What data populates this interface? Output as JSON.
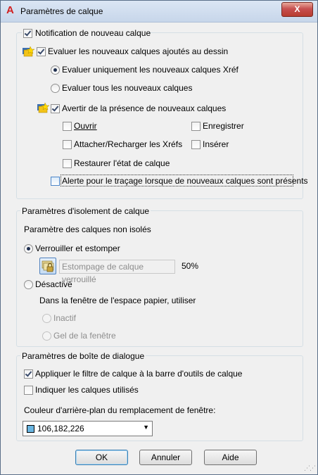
{
  "window": {
    "title": "Paramètres de calque",
    "close_label": "X",
    "app_icon": "autocad-a-icon"
  },
  "notification": {
    "legend": "Notification de nouveau calque",
    "legend_checked": true,
    "evaluate": {
      "label": "Evaluer les nouveaux calques ajoutés au dessin",
      "checked": true
    },
    "radio_xref": {
      "label": "Evaluer uniquement les nouveaux calques Xréf",
      "checked": true
    },
    "radio_all": {
      "label": "Evaluer tous les nouveaux calques",
      "checked": false
    },
    "warn": {
      "label": "Avertir de la présence de nouveaux calques",
      "checked": true
    },
    "opts": {
      "open": "Ouvrir",
      "save": "Enregistrer",
      "attach": "Attacher/Recharger les Xréfs",
      "insert": "Insérer",
      "restore": "Restaurer l'état de calque"
    },
    "plot_alert": {
      "label": "Alerte pour le traçage lorsque de nouveaux calques sont présents",
      "checked": false
    }
  },
  "isolation": {
    "legend": "Paramètres d'isolement de calque",
    "subtitle": "Paramètre des calques non isolés",
    "radio_lock": {
      "label": "Verrouiller et estomper",
      "checked": true
    },
    "fade_label": "Estompage de calque verrouillé",
    "fade_value": "50%",
    "radio_off": {
      "label": "Désactivé",
      "checked": false
    },
    "paper_label": "Dans la fenêtre de l'espace papier, utiliser",
    "inactive": "Inactif",
    "freeze": "Gel de la fenêtre"
  },
  "dialog_params": {
    "legend": "Paramètres de boîte de dialogue",
    "apply_filter": {
      "label": "Appliquer le filtre de calque à la barre d'outils de calque",
      "checked": true
    },
    "show_used": {
      "label": "Indiquer les calques utilisés",
      "checked": false
    },
    "bg_color_label": "Couleur d'arrière-plan du remplacement de fenêtre:",
    "bg_color_value": "106,182,226",
    "bg_color_hex": "#6ab6e2"
  },
  "buttons": {
    "ok": "OK",
    "cancel": "Annuler",
    "help": "Aide"
  }
}
